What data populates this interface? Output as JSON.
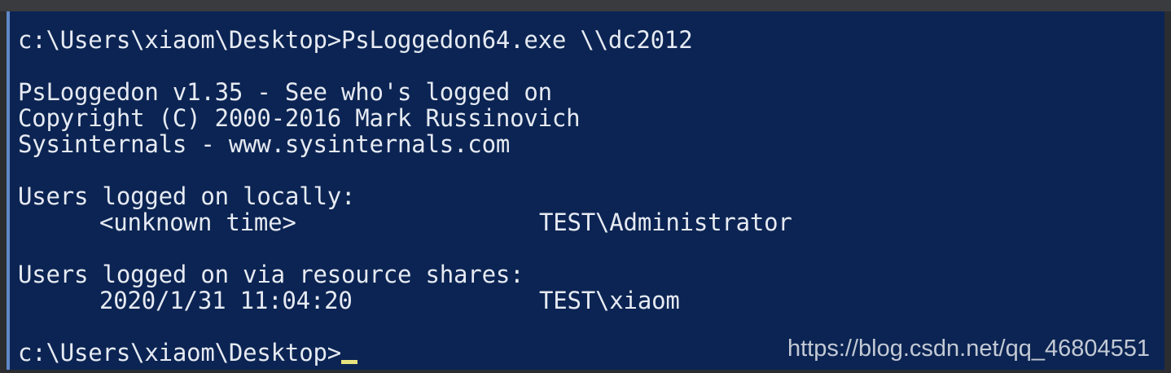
{
  "terminal": {
    "command_line": "c:\\Users\\xiaom\\Desktop>PsLoggedon64.exe \\\\dc2012",
    "banner_line1": "PsLoggedon v1.35 - See who's logged on",
    "banner_line2": "Copyright (C) 2000-2016 Mark Russinovich",
    "banner_line3": "Sysinternals - www.sysinternals.com",
    "local_header": "Users logged on locally:",
    "local_rows": [
      {
        "time": "<unknown time>",
        "user": "TEST\\Administrator"
      }
    ],
    "shares_header": "Users logged on via resource shares:",
    "share_rows": [
      {
        "time": "2020/1/31 11:04:20",
        "user": "TEST\\xiaom"
      }
    ],
    "prompt": "c:\\Users\\xiaom\\Desktop>"
  },
  "watermark": "https://blog.csdn.net/qq_46804551",
  "colors": {
    "terminal_bg": "#0b2453",
    "text": "#e6eaf2",
    "cursor": "#e7e27e",
    "border": "#5f88c7"
  }
}
